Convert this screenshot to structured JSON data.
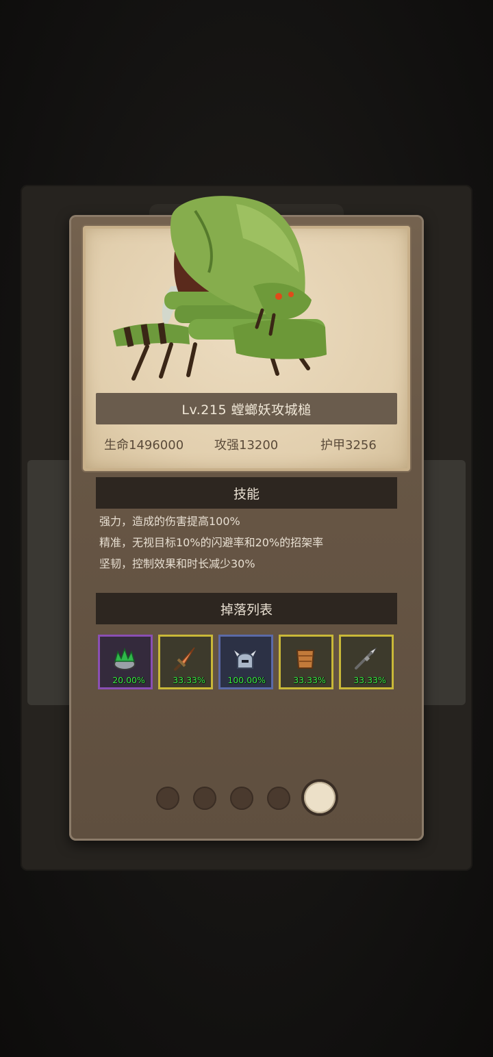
{
  "monster": {
    "name": "Lv.215 螳螂妖攻城槌",
    "stats": [
      {
        "label": "生命1496000"
      },
      {
        "label": "攻强13200"
      },
      {
        "label": "护甲3256"
      }
    ]
  },
  "skills": {
    "title": "技能",
    "lines": [
      "强力，造成的伤害提高100%",
      "精准，无视目标10%的闪避率和20%的招架率",
      "坚韧，控制效果和时长减少30%"
    ]
  },
  "drops": {
    "title": "掉落列表",
    "items": [
      {
        "icon": "green-crown-icon",
        "chance": "20.00%",
        "rarity_color": "#8a4fb4"
      },
      {
        "icon": "dagger-icon",
        "chance": "33.33%",
        "rarity_color": "#c9b838"
      },
      {
        "icon": "horned-helmet-icon",
        "chance": "100.00%",
        "rarity_color": "#5b6aa8"
      },
      {
        "icon": "leather-armor-icon",
        "chance": "33.33%",
        "rarity_color": "#c9b838"
      },
      {
        "icon": "spear-icon",
        "chance": "33.33%",
        "rarity_color": "#c9b838"
      }
    ]
  },
  "pagination": {
    "total": 5,
    "current": 5
  }
}
